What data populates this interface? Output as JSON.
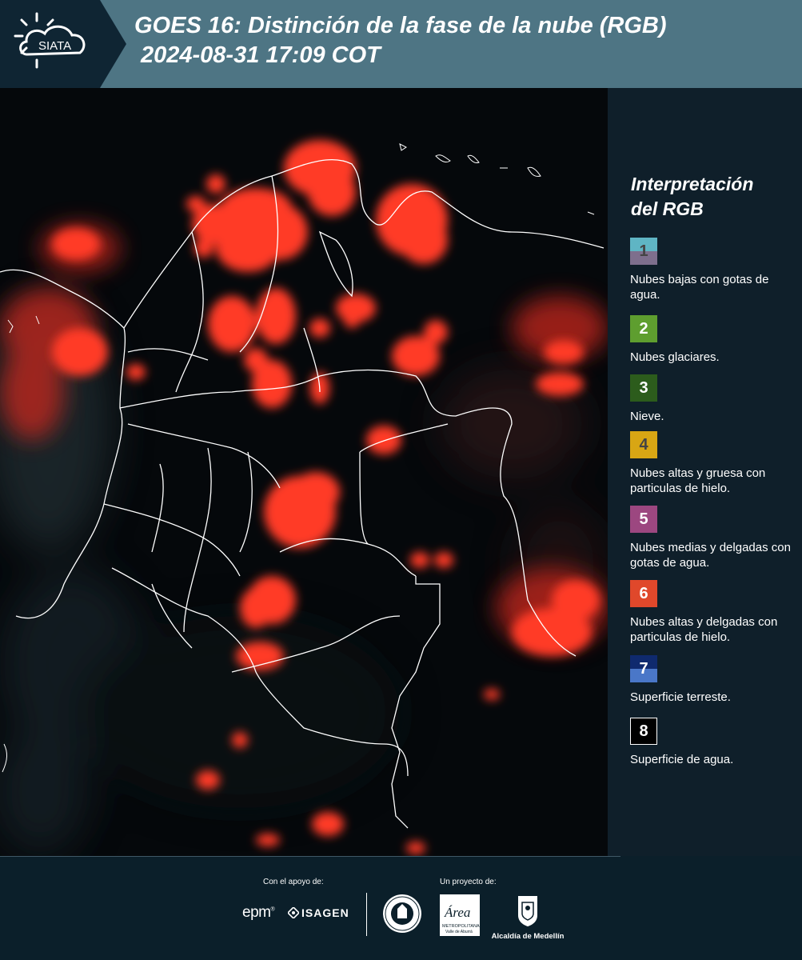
{
  "header": {
    "logo_text": "SIATA",
    "title_line1": "GOES 16: Distinción de la fase de la nube (RGB)",
    "title_line2": "2024-08-31 17:09 COT"
  },
  "legend": {
    "title_line1": "Interpretación",
    "title_line2": "del RGB",
    "items": [
      {
        "num": "1",
        "label": "Nubes bajas con gotas de agua.",
        "color_top": "#5fb5c4",
        "color_bottom": "#7e6f8d",
        "num_color": "#444444"
      },
      {
        "num": "2",
        "label": "Nubes glaciares.",
        "color_top": "#5e9e2f",
        "color_bottom": "#5e9e2f",
        "num_color": "#ffffff"
      },
      {
        "num": "3",
        "label": "Nieve.",
        "color_top": "#2c5c1c",
        "color_bottom": "#2c5c1c",
        "num_color": "#ffffff"
      },
      {
        "num": "4",
        "label": "Nubes altas y gruesa con particulas de hielo.",
        "color_top": "#d8a614",
        "color_bottom": "#d8a614",
        "num_color": "#444444"
      },
      {
        "num": "5",
        "label": "Nubes medias y delgadas con gotas de agua.",
        "color_top": "#9c4780",
        "color_bottom": "#9c4780",
        "num_color": "#ffffff"
      },
      {
        "num": "6",
        "label": "Nubes altas y delgadas con particulas de hielo.",
        "color_top": "#e0482b",
        "color_bottom": "#e0482b",
        "num_color": "#ffffff"
      },
      {
        "num": "7",
        "label": "Superficie terreste.",
        "color_top": "#0f2a6e",
        "color_bottom": "#4a77c8",
        "num_color": "#ffffff"
      },
      {
        "num": "8",
        "label": "Superficie de agua.",
        "color_top": "#000000",
        "color_bottom": "#000000",
        "num_color": "#ffffff"
      }
    ]
  },
  "footer": {
    "support_label": "Con el apoyo de:",
    "project_label": "Un proyecto de:",
    "epm_text": "epm",
    "isagen_text": "ISAGEN",
    "area_text": "Área",
    "area_subtext": "METROPOLITANA",
    "area_subtext2": "Valle de Aburrá",
    "alcaldia_text": "Alcaldía de Medellín"
  },
  "colors": {
    "header_bg": "#4e7584",
    "panel_bg": "#0f1f2a",
    "cloud_red": "#ff3a28",
    "border_white": "#ffffff"
  }
}
